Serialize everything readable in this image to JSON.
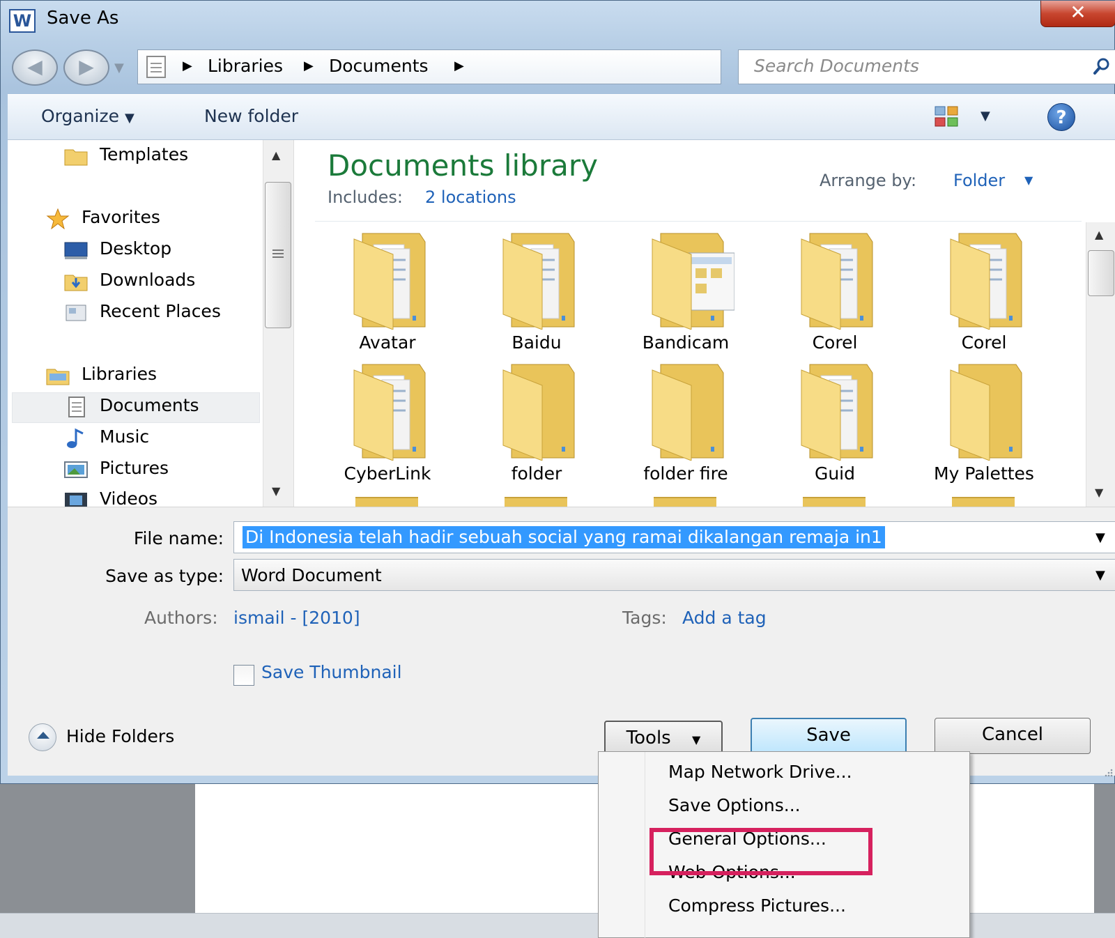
{
  "window": {
    "title": "Save As",
    "app_icon": "W",
    "close_glyph": "✕"
  },
  "navigation": {
    "back_glyph": "◀",
    "forward_glyph": "▶"
  },
  "address": {
    "crumbs": [
      "Libraries",
      "Documents"
    ],
    "refresh_glyph": "↻"
  },
  "search": {
    "placeholder": "Search Documents"
  },
  "toolbar": {
    "organize": "Organize",
    "new_folder": "New folder",
    "help": "?"
  },
  "nav": {
    "templates": "Templates",
    "favorites": "Favorites",
    "desktop": "Desktop",
    "downloads": "Downloads",
    "recent_places": "Recent Places",
    "libraries": "Libraries",
    "documents": "Documents",
    "music": "Music",
    "pictures": "Pictures",
    "videos": "Videos"
  },
  "library": {
    "title": "Documents library",
    "includes_label": "Includes:",
    "includes_link": "2 locations",
    "arrange_label": "Arrange by:",
    "arrange_value": "Folder"
  },
  "folders": [
    {
      "name": "Avatar",
      "variant": "papers"
    },
    {
      "name": "Baidu",
      "variant": "papers"
    },
    {
      "name": "Bandicam",
      "variant": "screenshot"
    },
    {
      "name": "Corel",
      "variant": "papers"
    },
    {
      "name": "Corel",
      "variant": "papers"
    },
    {
      "name": "CyberLink",
      "variant": "papers"
    },
    {
      "name": "folder",
      "variant": "empty"
    },
    {
      "name": "folder fire",
      "variant": "empty"
    },
    {
      "name": "Guid",
      "variant": "papers"
    },
    {
      "name": "My Palettes",
      "variant": "empty"
    }
  ],
  "form": {
    "file_name_label": "File name:",
    "file_name_value": "Di Indonesia telah hadir sebuah social yang ramai dikalangan remaja in1",
    "save_type_label": "Save as type:",
    "save_type_value": "Word Document",
    "authors_label": "Authors:",
    "authors_value": "ismail - [2010]",
    "tags_label": "Tags:",
    "tags_value": "Add a tag",
    "save_thumbnail": "Save Thumbnail",
    "save_thumbnail_checked": false
  },
  "buttons": {
    "hide_folders": "Hide Folders",
    "tools": "Tools",
    "save": "Save",
    "cancel": "Cancel"
  },
  "tools_menu": {
    "items": [
      "Map Network Drive...",
      "Save Options...",
      "General Options...",
      "Web Options...",
      "Compress Pictures..."
    ],
    "highlighted": "General Options..."
  },
  "colors": {
    "highlight_outline": "#d6215e",
    "link": "#1f62b8",
    "library_title": "#1b7a3a",
    "selection": "#3399ff"
  }
}
